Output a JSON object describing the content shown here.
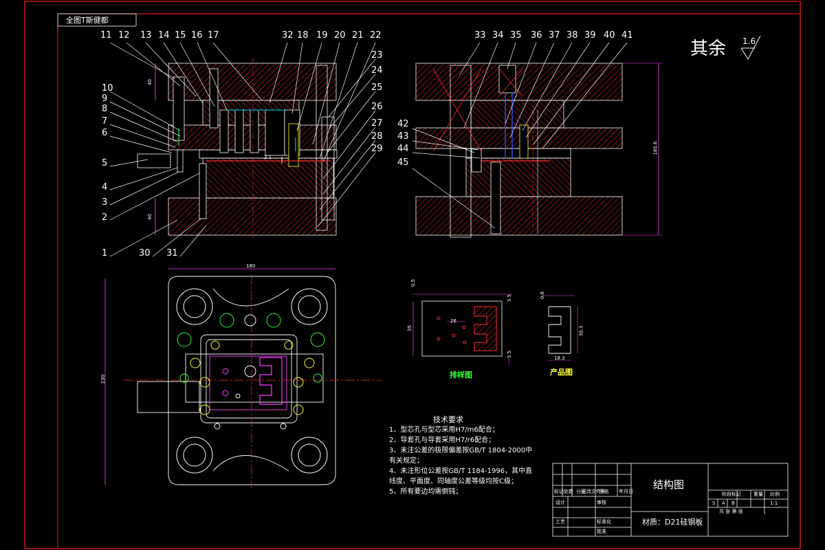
{
  "sheet": {
    "corner_label": "全图T斯健都",
    "roughness_prefix": "其余",
    "roughness_value": "1.6"
  },
  "dimensions": {
    "upper_height_left": "40",
    "lower_height_left": "40",
    "total_height_right": "185.6",
    "plan_width": "180",
    "plan_height": "230",
    "strip_height": "35",
    "strip_pitch": "26",
    "strip_top": "0.5",
    "strip_right": "3.5",
    "strip_bottom": "3.5",
    "product_top": "0.6",
    "product_height": "30.3",
    "product_width": "18.3",
    "small_dim": "2.1"
  },
  "part_numbers_left": {
    "top_row": [
      "11",
      "12",
      "13",
      "14",
      "15",
      "16",
      "17",
      "32",
      "18",
      "19",
      "20",
      "21",
      "22"
    ],
    "right_col": [
      "23",
      "24",
      "25",
      "26",
      "27",
      "28",
      "29"
    ],
    "left_col": [
      "10",
      "9",
      "8",
      "7",
      "6",
      "5",
      "4",
      "3",
      "2",
      "1"
    ],
    "bottom_row": [
      "30",
      "31"
    ]
  },
  "part_numbers_right": {
    "top_row": [
      "33",
      "34",
      "35",
      "36",
      "37",
      "38",
      "39",
      "40",
      "41"
    ],
    "left_col": [
      "42",
      "43",
      "44",
      "45"
    ]
  },
  "views": {
    "strip_caption": "排样图",
    "product_caption": "产品图"
  },
  "requirements": {
    "title": "技术要求",
    "items": [
      "1、型芯孔与型芯采用H7/m6配合；",
      "2、导套孔与导套采用H7/r6配合；",
      "3、未注公差的极限偏差按GB/T 1804-2000中",
      "    有关规定；",
      "4、未注形位公差按GB/T 1184-1996，其中直",
      "    线度、平面度、同轴度公差等级均按C级；",
      "5、所有要边均需倒钝；"
    ]
  },
  "title_block": {
    "drawing_name": "结构图",
    "material": "材质：D21硅钢板",
    "labels_left": [
      "标记",
      "处数",
      "分区",
      "更改文件号",
      "签名",
      "年月日"
    ],
    "row_labels": [
      "设计",
      "审核",
      "工艺",
      "标准化",
      "批准"
    ],
    "stage_label": "阶段标记",
    "weight_label": "重量",
    "scale_label": "比例",
    "scale_value": "1:1",
    "sheet_label": "共 张 第 张",
    "stage_marks": [
      "S",
      "A",
      "B"
    ]
  },
  "colors": {
    "frame": "#ff2020",
    "lines": "#ffffff",
    "hatch": "#ff3030",
    "cyan": "#00e5ff",
    "green": "#33ff33",
    "magenta": "#ff40ff",
    "yellow": "#ffff33",
    "blue": "#3050ff"
  }
}
